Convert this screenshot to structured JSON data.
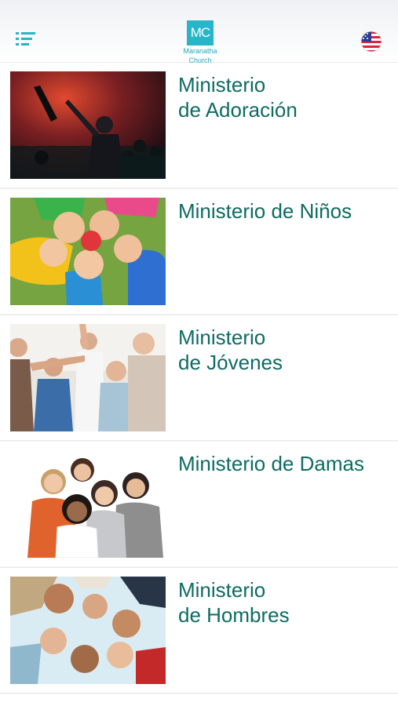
{
  "header": {
    "logo": {
      "mark": "MC",
      "name_line1": "Maranatha",
      "name_line2": "Church"
    },
    "menu_icon": "menu-list-icon",
    "language_icon": "us-flag-icon"
  },
  "ministries": [
    {
      "line1": "Ministerio",
      "line2": "de Adoración",
      "image": "worship-concert-photo"
    },
    {
      "line1": "Ministerio de Niños",
      "line2": "",
      "image": "children-circle-photo"
    },
    {
      "line1": "Ministerio",
      "line2": "de Jóvenes",
      "image": "youth-group-photo"
    },
    {
      "line1": "Ministerio de Damas",
      "line2": "",
      "image": "women-group-photo"
    },
    {
      "line1": "Ministerio",
      "line2": "de Hombres",
      "image": "men-huddle-photo"
    }
  ],
  "colors": {
    "title": "#0e6b63",
    "accent": "#27b6c9"
  }
}
